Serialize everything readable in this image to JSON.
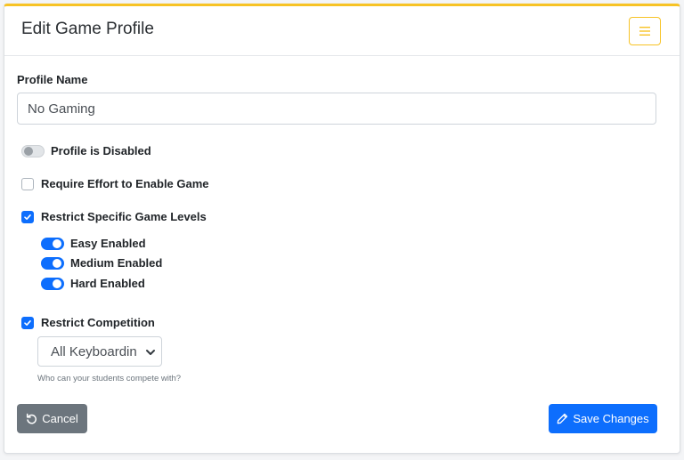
{
  "header": {
    "title": "Edit Game Profile",
    "menu_icon": "hamburger-icon"
  },
  "colors": {
    "accent_yellow": "#f7c325",
    "primary_blue": "#0d6efd",
    "secondary_gray": "#6c757d"
  },
  "profile": {
    "name_label": "Profile Name",
    "name_value": "No Gaming"
  },
  "toggles": {
    "disabled": {
      "label": "Profile is Disabled",
      "on": false
    }
  },
  "options": {
    "require_effort": {
      "label": "Require Effort to Enable Game",
      "checked": false
    },
    "restrict_levels": {
      "label": "Restrict Specific Game Levels",
      "checked": true,
      "levels": [
        {
          "label": "Easy Enabled",
          "on": true
        },
        {
          "label": "Medium Enabled",
          "on": true
        },
        {
          "label": "Hard Enabled",
          "on": true
        }
      ]
    },
    "restrict_competition": {
      "label": "Restrict Competition",
      "checked": true,
      "select_value": "All Keyboardin",
      "help": "Who can your students compete with?"
    }
  },
  "footer": {
    "cancel_label": "Cancel",
    "cancel_icon": "undo-icon",
    "save_label": "Save Changes",
    "save_icon": "pencil-icon"
  }
}
